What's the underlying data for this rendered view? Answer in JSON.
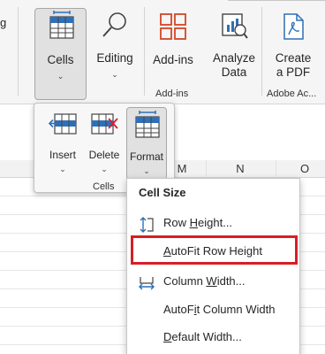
{
  "ribbon": {
    "truncated_left_text": "g",
    "cells": {
      "label": "Cells",
      "caret": "⌄"
    },
    "editing": {
      "label": "Editing",
      "caret": "⌄"
    },
    "addins": {
      "label": "Add-ins"
    },
    "analyze": {
      "label_line1": "Analyze",
      "label_line2": "Data"
    },
    "create_pdf": {
      "label_line1": "Create",
      "label_line2": "a PDF"
    },
    "groups": {
      "addins": "Add-ins",
      "adobe": "Adobe Ac..."
    }
  },
  "sheet": {
    "columns": [
      "M",
      "N",
      "O"
    ]
  },
  "cells_popup": {
    "insert": {
      "label": "Insert",
      "caret": "⌄"
    },
    "delete": {
      "label": "Delete",
      "caret": "⌄"
    },
    "format": {
      "label": "Format",
      "caret": "⌄"
    },
    "group_label": "Cells"
  },
  "format_menu": {
    "heading": "Cell Size",
    "items": [
      {
        "pre": "Row ",
        "u": "H",
        "post": "eight...",
        "icon": "row-height-icon"
      },
      {
        "pre": "",
        "u": "A",
        "post": "utoFit Row Height",
        "icon": ""
      },
      {
        "pre": "Column ",
        "u": "W",
        "post": "idth...",
        "icon": "column-width-icon"
      },
      {
        "pre": "AutoF",
        "u": "i",
        "post": "t Column Width",
        "icon": ""
      },
      {
        "pre": "",
        "u": "D",
        "post": "efault Width...",
        "icon": ""
      }
    ]
  },
  "colors": {
    "accent_blue": "#2f6fb7",
    "accent_orange": "#d24726",
    "highlight_red": "#d61f26"
  }
}
